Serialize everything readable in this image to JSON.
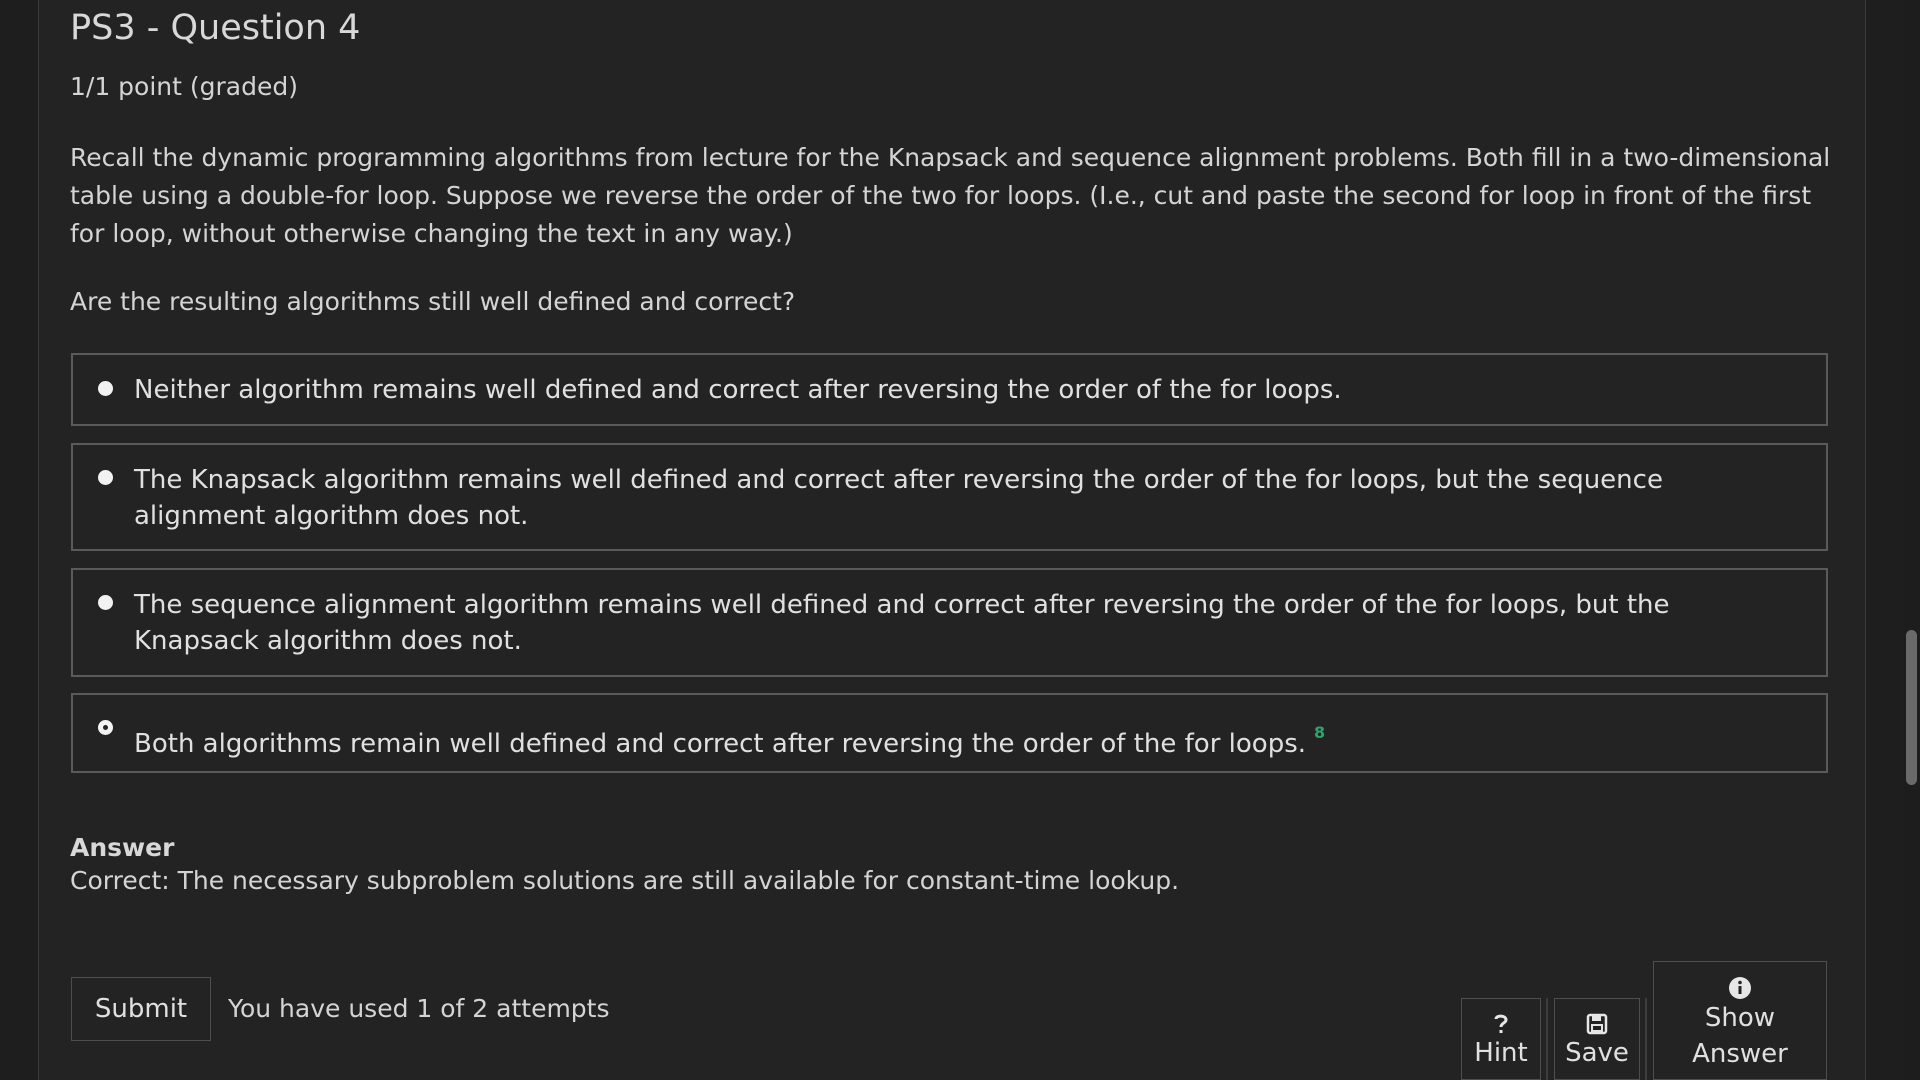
{
  "problem": {
    "title": "PS3 - Question 4",
    "points": "1/1 point (graded)",
    "prompt": "Recall the dynamic programming algorithms from lecture for the Knapsack and sequence alignment problems. Both fill in a two-dimensional table using a double-for loop. Suppose we reverse the order of the two for loops. (I.e., cut and paste the second for loop in front of the first for loop, without otherwise changing the text in any way.)",
    "question": "Are the resulting algorithms still well defined and correct?"
  },
  "options": [
    {
      "label": "Neither algorithm remains well defined and correct after reversing the order of the for loops.",
      "selected": false
    },
    {
      "label": "The Knapsack algorithm remains well defined and correct after reversing the order of the for loops, but the sequence alignment algorithm does not.",
      "selected": false
    },
    {
      "label": "The sequence alignment algorithm remains well defined and correct after reversing the order of the for loops, but the Knapsack algorithm does not.",
      "selected": false
    },
    {
      "label": "Both algorithms remain well defined and correct after reversing the order of the for loops.",
      "selected": true,
      "mark": "8"
    }
  ],
  "answer": {
    "heading": "Answer",
    "text": "Correct:  The necessary subproblem solutions are still available for constant-time lookup."
  },
  "actions": {
    "submit_label": "Submit",
    "attempts_text": "You have used 1 of 2 attempts",
    "hint_label": "Hint",
    "save_label": "Save",
    "show_answer_label_1": "Show",
    "show_answer_label_2": "Answer"
  },
  "colors": {
    "background": "#232323",
    "text": "#d4d4d4",
    "border": "#5a5a5a",
    "correct": "#2fa36b"
  },
  "icons": {
    "hint": "question-icon",
    "save": "floppy-disk-icon",
    "show_answer": "info-circle-icon"
  }
}
